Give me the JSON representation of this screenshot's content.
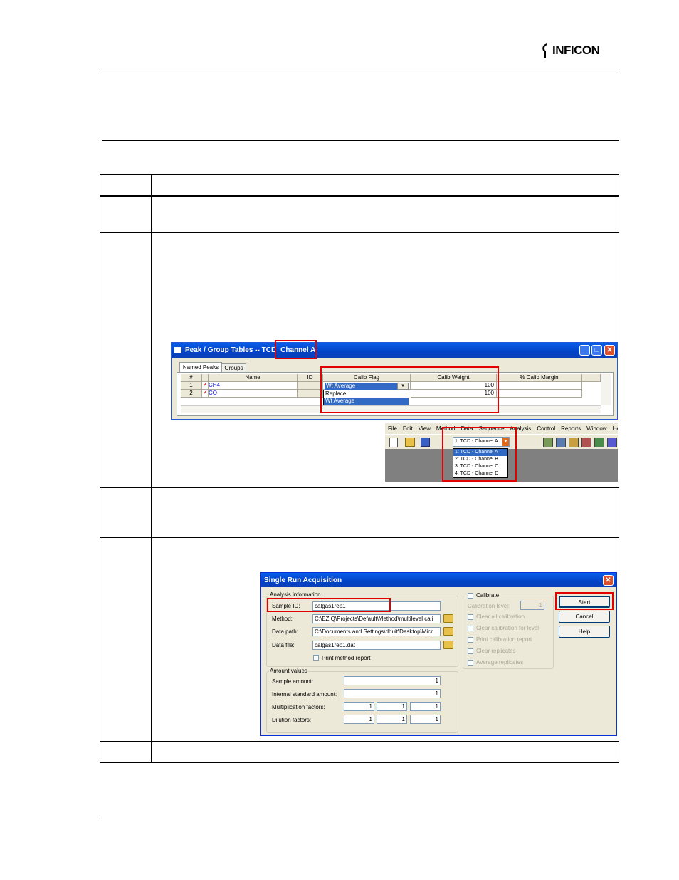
{
  "header": {
    "logo_text": "INFICON"
  },
  "peak_window": {
    "title_prefix": "Peak / Group Tables -- TCD",
    "title_channel": "Channel A",
    "tabs": [
      "Named Peaks",
      "Groups"
    ],
    "columns": [
      "#",
      "Name",
      "ID",
      "Calib Flag",
      "Calib Weight",
      "% Calib Margin"
    ],
    "rows": [
      {
        "num": "1",
        "name": "CH4",
        "flag": "Wt Average",
        "weight": "100"
      },
      {
        "num": "2",
        "name": "CO",
        "flag": "",
        "weight": "100"
      }
    ],
    "dropdown_options": [
      "Replace",
      "Wt Average"
    ]
  },
  "main_toolbar": {
    "menu": [
      "File",
      "Edit",
      "View",
      "Method",
      "Data",
      "Sequence",
      "Analysis",
      "Control",
      "Reports",
      "Window",
      "Help"
    ],
    "channel_selected": "1: TCD - Channel A",
    "channel_options": [
      "1: TCD - Channel A",
      "2: TCD - Channel B",
      "3: TCD - Channel C",
      "4: TCD - Channel D"
    ]
  },
  "acq_dialog": {
    "title": "Single Run Acquisition",
    "analysis_group": "Analysis information",
    "sample_id_label": "Sample ID:",
    "sample_id_value": "calgas1rep1",
    "method_label": "Method:",
    "method_value": "C:\\EZIQ\\Projects\\Default\\Method\\multilevel cali",
    "data_path_label": "Data path:",
    "data_path_value": "C:\\Documents and Settings\\dhuit\\Desktop\\Micr",
    "data_file_label": "Data file:",
    "data_file_value": "calgas1rep1.dat",
    "print_method_label": "Print method report",
    "calibrate_label": "Calibrate",
    "calibration_level_label": "Calibration level:",
    "calibration_level_value": "1",
    "cal_options": [
      "Clear all calibration",
      "Clear calibration for level",
      "Print calibration report",
      "Clear replicates",
      "Average replicates"
    ],
    "buttons": {
      "start": "Start",
      "cancel": "Cancel",
      "help": "Help"
    },
    "amount_group": "Amount values",
    "sample_amount_label": "Sample amount:",
    "sample_amount_value": "1",
    "internal_std_label": "Internal standard amount:",
    "internal_std_value": "1",
    "mult_label": "Multiplication factors:",
    "mult_values": [
      "1",
      "1",
      "1"
    ],
    "dilution_label": "Dilution factors:",
    "dilution_values": [
      "1",
      "1",
      "1"
    ]
  }
}
